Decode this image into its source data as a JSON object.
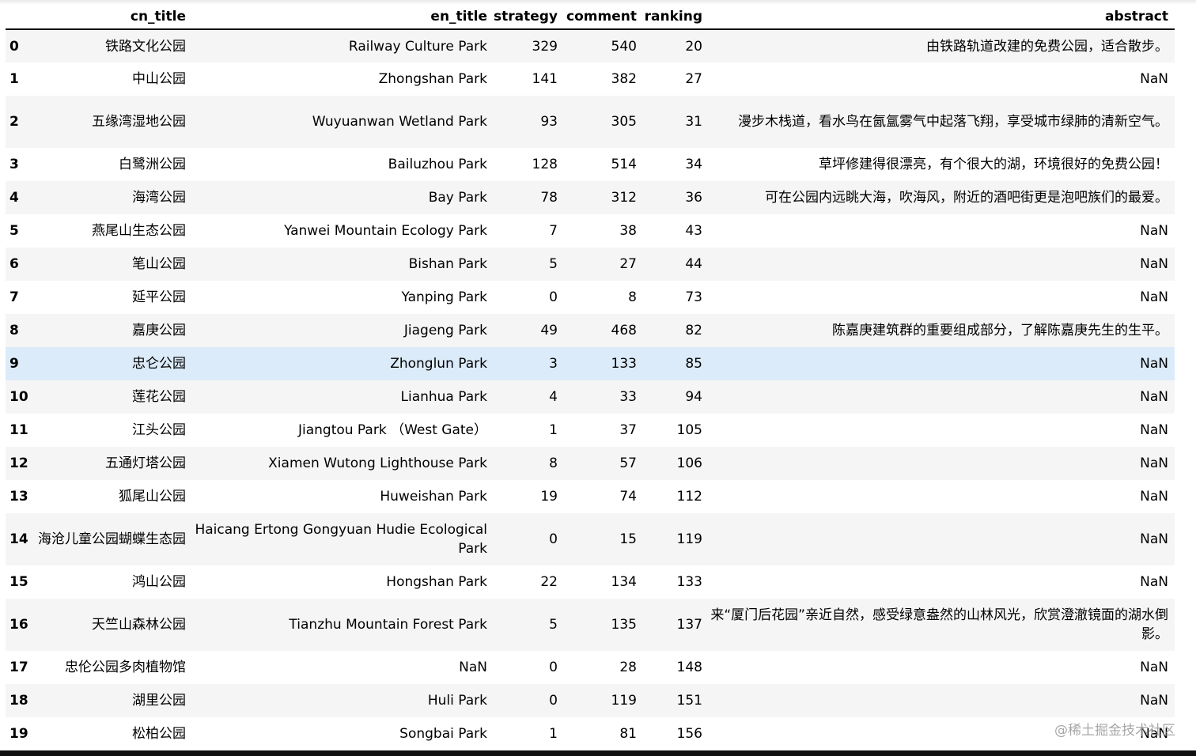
{
  "columns": {
    "index": "",
    "cn_title": "cn_title",
    "en_title": "en_title",
    "strategy": "strategy",
    "comment": "comment",
    "ranking": "ranking",
    "abstract": "abstract"
  },
  "rows": [
    {
      "idx": "0",
      "cn": "铁路文化公园",
      "en": "Railway Culture Park",
      "strategy": "329",
      "comment": "540",
      "ranking": "20",
      "abstract": "由铁路轨道改建的免费公园，适合散步。"
    },
    {
      "idx": "1",
      "cn": "中山公园",
      "en": "Zhongshan Park",
      "strategy": "141",
      "comment": "382",
      "ranking": "27",
      "abstract": "NaN"
    },
    {
      "idx": "2",
      "cn": "五缘湾湿地公园",
      "en": "Wuyuanwan Wetland Park",
      "strategy": "93",
      "comment": "305",
      "ranking": "31",
      "abstract": "漫步木栈道，看水鸟在氤氲雾气中起落飞翔，享受城市绿肺的清新空气。"
    },
    {
      "idx": "3",
      "cn": "白鹭洲公园",
      "en": "Bailuzhou Park",
      "strategy": "128",
      "comment": "514",
      "ranking": "34",
      "abstract": "草坪修建得很漂亮，有个很大的湖，环境很好的免费公园！"
    },
    {
      "idx": "4",
      "cn": "海湾公园",
      "en": "Bay Park",
      "strategy": "78",
      "comment": "312",
      "ranking": "36",
      "abstract": "可在公园内远眺大海，吹海风，附近的酒吧街更是泡吧族们的最爱。"
    },
    {
      "idx": "5",
      "cn": "燕尾山生态公园",
      "en": "Yanwei Mountain Ecology Park",
      "strategy": "7",
      "comment": "38",
      "ranking": "43",
      "abstract": "NaN"
    },
    {
      "idx": "6",
      "cn": "笔山公园",
      "en": "Bishan Park",
      "strategy": "5",
      "comment": "27",
      "ranking": "44",
      "abstract": "NaN"
    },
    {
      "idx": "7",
      "cn": "延平公园",
      "en": "Yanping Park",
      "strategy": "0",
      "comment": "8",
      "ranking": "73",
      "abstract": "NaN"
    },
    {
      "idx": "8",
      "cn": "嘉庚公园",
      "en": "Jiageng Park",
      "strategy": "49",
      "comment": "468",
      "ranking": "82",
      "abstract": "陈嘉庚建筑群的重要组成部分，了解陈嘉庚先生的生平。"
    },
    {
      "idx": "9",
      "cn": "忠仑公园",
      "en": "Zhonglun Park",
      "strategy": "3",
      "comment": "133",
      "ranking": "85",
      "abstract": "NaN"
    },
    {
      "idx": "10",
      "cn": "莲花公园",
      "en": "Lianhua Park",
      "strategy": "4",
      "comment": "33",
      "ranking": "94",
      "abstract": "NaN"
    },
    {
      "idx": "11",
      "cn": "江头公园",
      "en": "Jiangtou Park （West Gate）",
      "strategy": "1",
      "comment": "37",
      "ranking": "105",
      "abstract": "NaN"
    },
    {
      "idx": "12",
      "cn": "五通灯塔公园",
      "en": "Xiamen Wutong Lighthouse Park",
      "strategy": "8",
      "comment": "57",
      "ranking": "106",
      "abstract": "NaN"
    },
    {
      "idx": "13",
      "cn": "狐尾山公园",
      "en": "Huweishan Park",
      "strategy": "19",
      "comment": "74",
      "ranking": "112",
      "abstract": "NaN"
    },
    {
      "idx": "14",
      "cn": "海沧儿童公园蝴蝶生态园",
      "en": "Haicang Ertong Gongyuan Hudie Ecological Park",
      "strategy": "0",
      "comment": "15",
      "ranking": "119",
      "abstract": "NaN"
    },
    {
      "idx": "15",
      "cn": "鸿山公园",
      "en": "Hongshan Park",
      "strategy": "22",
      "comment": "134",
      "ranking": "133",
      "abstract": "NaN"
    },
    {
      "idx": "16",
      "cn": "天竺山森林公园",
      "en": "Tianzhu Mountain Forest Park",
      "strategy": "5",
      "comment": "135",
      "ranking": "137",
      "abstract": "来“厦门后花园”亲近自然，感受绿意盎然的山林风光，欣赏澄澈镜面的湖水倒影。"
    },
    {
      "idx": "17",
      "cn": "忠伦公园多肉植物馆",
      "en": "NaN",
      "strategy": "0",
      "comment": "28",
      "ranking": "148",
      "abstract": "NaN"
    },
    {
      "idx": "18",
      "cn": "湖里公园",
      "en": "Huli Park",
      "strategy": "0",
      "comment": "119",
      "ranking": "151",
      "abstract": "NaN"
    },
    {
      "idx": "19",
      "cn": "松柏公园",
      "en": "Songbai Park",
      "strategy": "1",
      "comment": "81",
      "ranking": "156",
      "abstract": "NaN"
    }
  ],
  "highlighted_row": 9,
  "tall_rows": [
    2,
    14,
    16
  ],
  "watermark": "@稀土掘金技术社区",
  "colors": {
    "stripe": "#f5f5f5",
    "hover": "#dcebf9",
    "header_border": "#000000"
  }
}
